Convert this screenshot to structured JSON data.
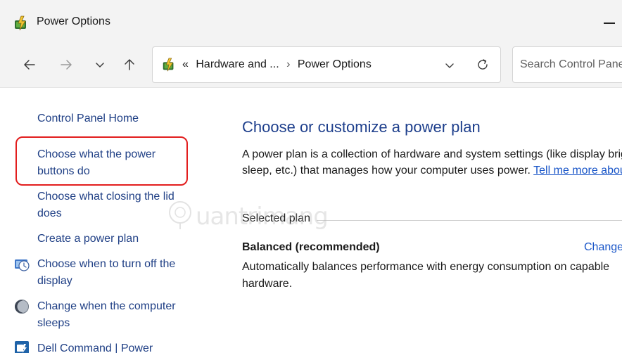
{
  "window": {
    "title": "Power Options",
    "app_icon": "power-options-icon"
  },
  "nav": {
    "back_icon": "arrow-left-icon",
    "forward_icon": "arrow-right-icon",
    "recent_icon": "chevron-down-icon",
    "up_icon": "arrow-up-icon",
    "address": {
      "overflow": "«",
      "crumbs": [
        "Hardware and ...",
        "Power Options"
      ],
      "separator": "›"
    },
    "search_placeholder": "Search Control Panel"
  },
  "sidebar": {
    "items": [
      {
        "label": "Control Panel Home"
      },
      {
        "label": "Choose what the power buttons do",
        "highlighted": true
      },
      {
        "label": "Choose what closing the lid does"
      },
      {
        "label": "Create a power plan"
      },
      {
        "label": "Choose when to turn off the display",
        "icon": "display-clock-icon"
      },
      {
        "label": "Change when the computer sleeps",
        "icon": "moon-icon"
      },
      {
        "label": "Dell Command | Power",
        "icon": "dell-command-icon"
      }
    ]
  },
  "main": {
    "heading": "Choose or customize a power plan",
    "description_line1": "A power plan is a collection of hardware and system settings (like display brightness,",
    "description_line2_text": "sleep, etc.) that manages how your computer uses power. ",
    "tell_me_more_link": "Tell me more about power plans",
    "selected_plan_label": "Selected plan",
    "plan": {
      "name": "Balanced (recommended)",
      "change_link": "Change plan settings",
      "description_line1": "Automatically balances performance with energy consumption on capable",
      "description_line2": "hardware."
    }
  },
  "watermark": {
    "text": "uantrimang"
  },
  "colors": {
    "link": "#1f3f85",
    "heading": "#1e3f8c",
    "highlight_border": "#e21e1e",
    "titlebar_bg": "#f3f3f3"
  }
}
